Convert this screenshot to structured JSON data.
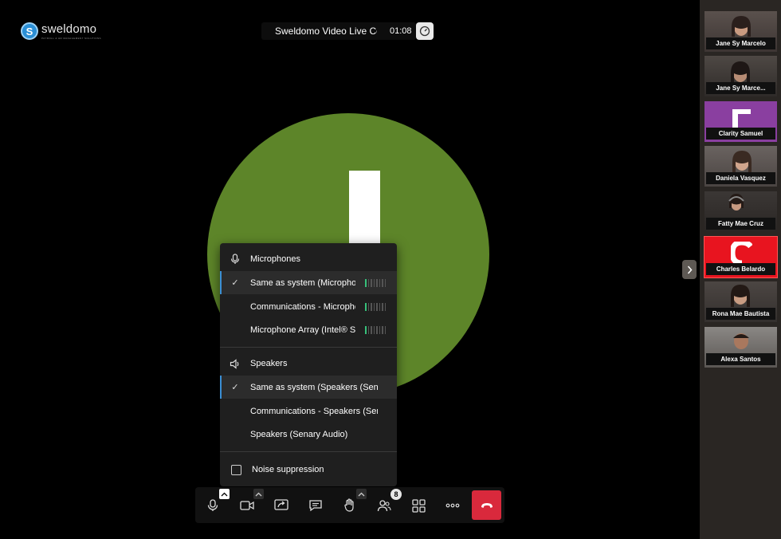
{
  "app": {
    "brand_name": "sweldomo",
    "brand_tagline": "PAYROLL & HR MANAGEMENT SOLUTIONS",
    "brand_colors": {
      "accent": "#2a8fd6",
      "end_call": "#d9293c",
      "avatar_bg": "#5d8529",
      "level_on": "#36c07a",
      "selected_marker": "#3b8fd4"
    }
  },
  "header": {
    "meeting_title": "Sweldomo Video Live Con",
    "timer": "01:08",
    "performance_icon": "speedometer-icon"
  },
  "device_menu": {
    "microphones_title": "Microphones",
    "microphones": [
      {
        "label": "Same as system (Microphone Array (Intel® Smart Sound Technology))",
        "selected": true,
        "level": 0.15
      },
      {
        "label": "Communications - Microphone Array (Intel® Smart Sound Technology)",
        "selected": false,
        "level": 0.15
      },
      {
        "label": "Microphone Array (Intel® Smart Sound Technology)",
        "selected": false,
        "level": 0.15
      }
    ],
    "speakers_title": "Speakers",
    "speakers": [
      {
        "label": "Same as system (Speakers (Senary Audio))",
        "selected": true
      },
      {
        "label": "Communications - Speakers (Senary Audio)",
        "selected": false
      },
      {
        "label": "Speakers (Senary Audio)",
        "selected": false
      }
    ],
    "noise_suppression_label": "Noise suppression",
    "noise_suppression_checked": false
  },
  "toolbar": {
    "participants_count": "8",
    "buttons": [
      "microphone-icon",
      "camera-icon",
      "share-screen-icon",
      "chat-icon",
      "raise-hand-icon",
      "participants-icon",
      "tile-view-icon",
      "more-icon",
      "hangup-icon"
    ]
  },
  "sidebar": {
    "participants": [
      {
        "name": "Jane Sy Marcelo",
        "kind": "video"
      },
      {
        "name": "Jane Sy Marce...",
        "kind": "video"
      },
      {
        "name": "Clarity Samuel",
        "kind": "avatar",
        "color": "#8a3fa0"
      },
      {
        "name": "Daniela Vasquez",
        "kind": "video"
      },
      {
        "name": "Fatty Mae Cruz",
        "kind": "video"
      },
      {
        "name": "Charles Belardo",
        "kind": "avatar",
        "color": "#e8141f"
      },
      {
        "name": "Rona Mae Bautista",
        "kind": "video"
      },
      {
        "name": "Alexa Santos",
        "kind": "video"
      }
    ]
  }
}
